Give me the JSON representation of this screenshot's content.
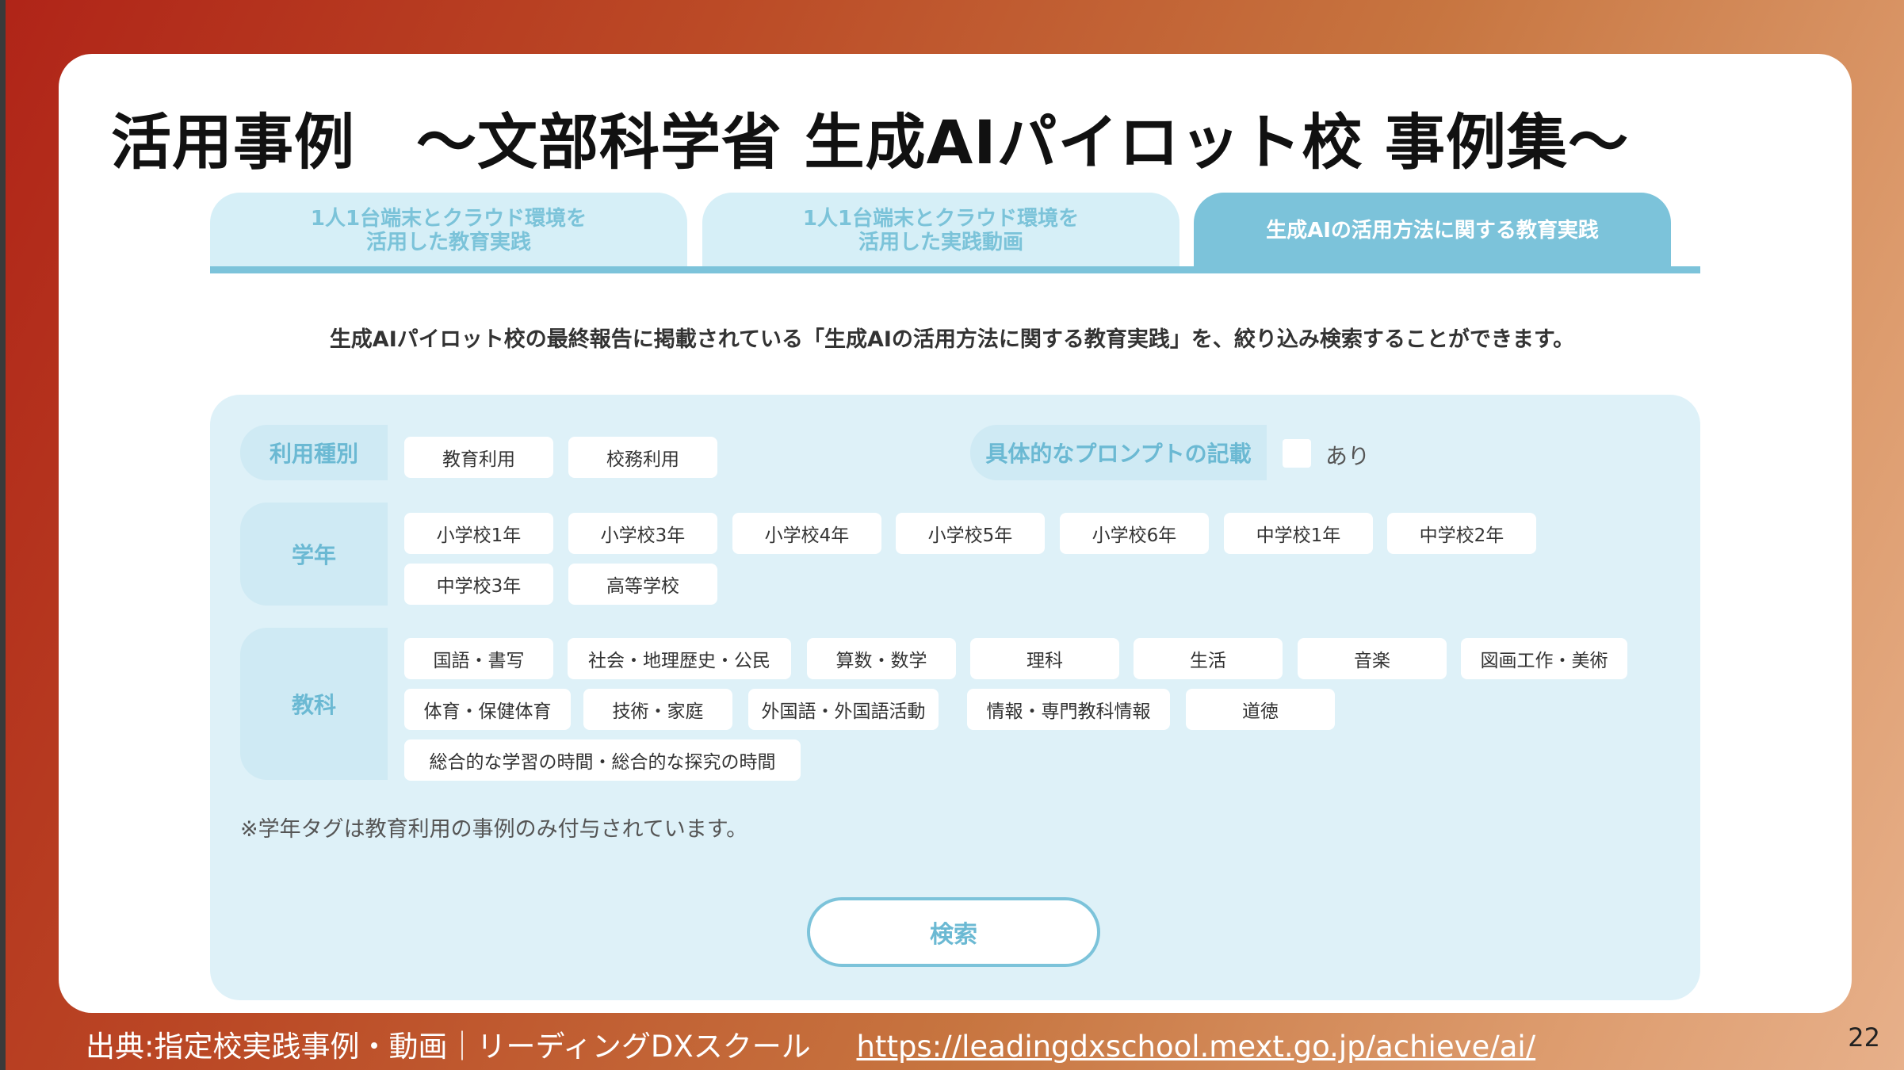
{
  "slide": {
    "title": "活用事例　～文部科学省 生成AIパイロット校 事例集～",
    "page_number": "22"
  },
  "tabs": [
    {
      "label": "1人1台端末とクラウド環境を\n活用した教育実践",
      "active": false
    },
    {
      "label": "1人1台端末とクラウド環境を\n活用した実践動画",
      "active": false
    },
    {
      "label": "生成AIの活用方法に関する教育実践",
      "active": true
    }
  ],
  "description": "生成AIパイロット校の最終報告に掲載されている「生成AIの活用方法に関する教育実践」を、絞り込み検索することができます。",
  "filters": {
    "usage": {
      "label": "利用種別",
      "options": [
        "教育利用",
        "校務利用"
      ]
    },
    "prompt": {
      "label": "具体的なプロンプトの記載",
      "checkbox_label": "あり",
      "checked": false
    },
    "grade": {
      "label": "学年",
      "options": [
        "小学校1年",
        "小学校3年",
        "小学校4年",
        "小学校5年",
        "小学校6年",
        "中学校1年",
        "中学校2年",
        "中学校3年",
        "高等学校"
      ]
    },
    "subject": {
      "label": "教科",
      "options": [
        "国語・書写",
        "社会・地理歴史・公民",
        "算数・数学",
        "理科",
        "生活",
        "音楽",
        "図画工作・美術",
        "体育・保健体育",
        "技術・家庭",
        "外国語・外国語活動",
        "情報・専門教科情報",
        "道徳",
        "総合的な学習の時間・総合的な探究の時間"
      ]
    },
    "note": "※学年タグは教育利用の事例のみ付与されています。",
    "search_label": "検索"
  },
  "footer": {
    "source": "出典:指定校実践事例・動画｜リーディングDXスクール",
    "url": "https://leadingdxschool.mext.go.jp/achieve/ai/"
  },
  "colors": {
    "accent": "#7cc3da",
    "panel": "#def1f8",
    "label_bg": "#cfeaf4"
  }
}
